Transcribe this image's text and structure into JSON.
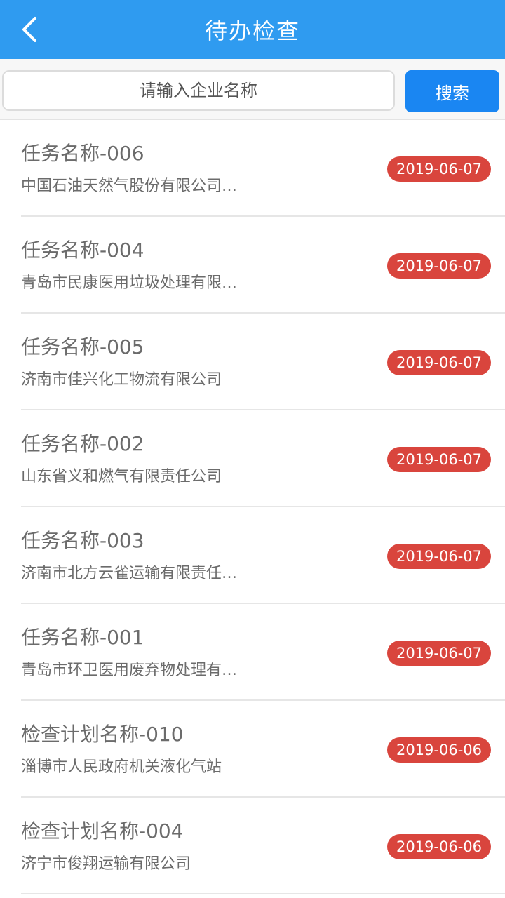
{
  "header": {
    "title": "待办检查",
    "back_icon": "chevron-left-icon"
  },
  "search": {
    "placeholder": "请输入企业名称",
    "button_label": "搜索"
  },
  "colors": {
    "header_bg": "#2f9bf0",
    "button_bg": "#1a86f2",
    "date_badge_bg": "#d9453d"
  },
  "items": [
    {
      "name": "任务名称-006",
      "company": "中国石油天然气股份有限公司…",
      "date": "2019-06-07"
    },
    {
      "name": "任务名称-004",
      "company": "青岛市民康医用垃圾处理有限…",
      "date": "2019-06-07"
    },
    {
      "name": "任务名称-005",
      "company": "济南市佳兴化工物流有限公司",
      "date": "2019-06-07"
    },
    {
      "name": "任务名称-002",
      "company": "山东省义和燃气有限责任公司",
      "date": "2019-06-07"
    },
    {
      "name": "任务名称-003",
      "company": "济南市北方云雀运输有限责任…",
      "date": "2019-06-07"
    },
    {
      "name": "任务名称-001",
      "company": "青岛市环卫医用废弃物处理有…",
      "date": "2019-06-07"
    },
    {
      "name": "检查计划名称-010",
      "company": "淄博市人民政府机关液化气站",
      "date": "2019-06-06"
    },
    {
      "name": "检查计划名称-004",
      "company": "济宁市俊翔运输有限公司",
      "date": "2019-06-06"
    }
  ]
}
